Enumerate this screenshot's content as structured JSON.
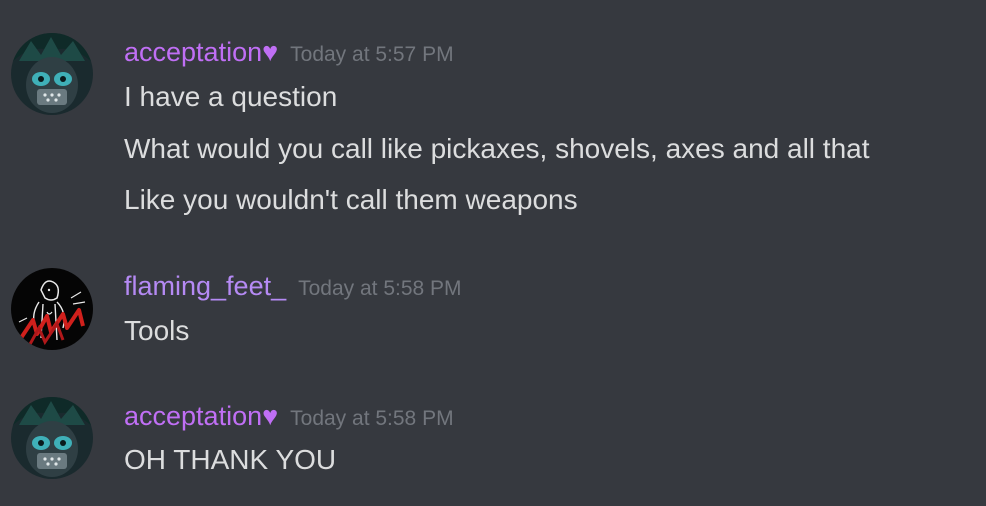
{
  "messages": [
    {
      "username": "acceptation♥",
      "timestamp": "Today at 5:57 PM",
      "avatar_icon": "anime-character-avatar",
      "lines": [
        "I have a question",
        "What would you call like pickaxes, shovels, axes and all that",
        "Like you wouldn't call them weapons"
      ]
    },
    {
      "username": "flaming_feet_",
      "timestamp": "Today at 5:58 PM",
      "avatar_icon": "sketch-figure-avatar",
      "lines": [
        "Tools"
      ]
    },
    {
      "username": "acceptation♥",
      "timestamp": "Today at 5:58 PM",
      "avatar_icon": "anime-character-avatar",
      "lines": [
        "OH THANK YOU"
      ]
    }
  ],
  "colors": {
    "background": "#36393f",
    "username_acceptation": "#c06ff5",
    "username_flaming": "#b58af4",
    "timestamp": "#72767d",
    "message_text": "#dcddde"
  }
}
